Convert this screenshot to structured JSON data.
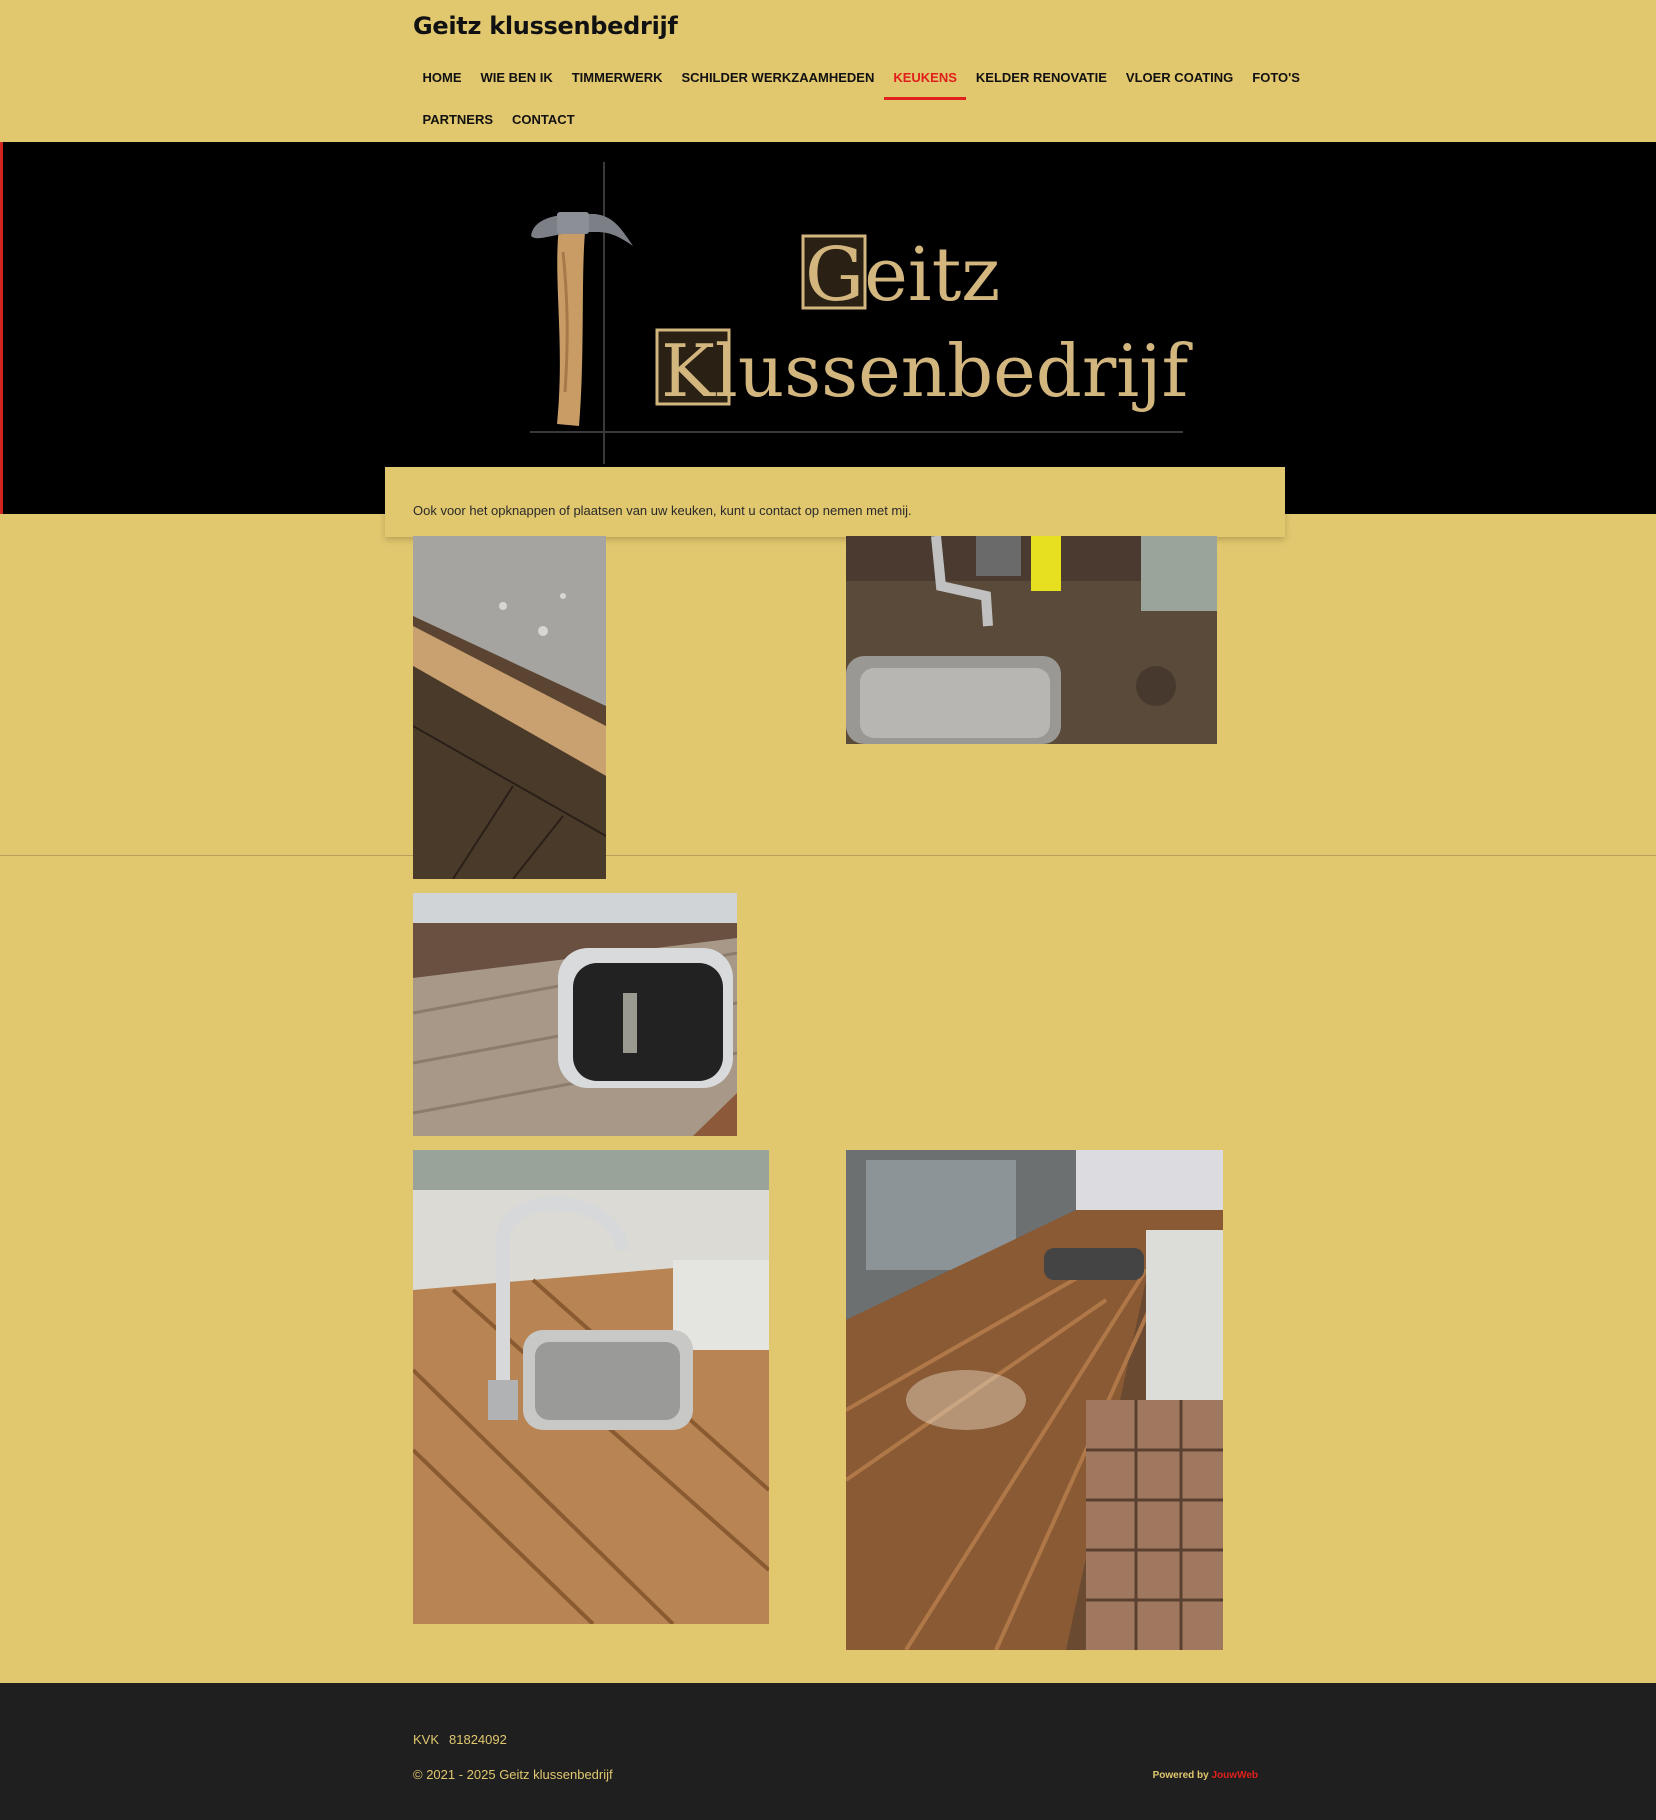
{
  "site": {
    "title": "Geitz klussenbedrijf"
  },
  "nav": {
    "row1": [
      "HOME",
      "WIE BEN IK",
      "TIMMERWERK",
      "SCHILDER WERKZAAMHEDEN",
      "KEUKENS",
      "KELDER RENOVATIE",
      "VLOER COATING",
      "FOTO'S"
    ],
    "row2": [
      "PARTNERS",
      "CONTACT"
    ],
    "active": "KEUKENS"
  },
  "hero": {
    "logo_line1": "Geitz",
    "logo_line2": "Klussenbedrijf"
  },
  "content": {
    "intro": "Ook voor het opknappen of plaatsen van uw keuken, kunt u contact op nemen met mij."
  },
  "photos": [
    {
      "subject": "stainless sink with wet wooden worktop edge"
    },
    {
      "subject": "old weathered worktop with tap and sink"
    },
    {
      "subject": "sanded worktop with removed sink cutout"
    },
    {
      "subject": "finished oak worktop with chrome tap and sink"
    },
    {
      "subject": "varnished worktop along window with sink"
    }
  ],
  "footer": {
    "kvk_label": "KVK",
    "kvk_number": "81824092",
    "copyright": "© 2021 - 2025 Geitz klussenbedrijf",
    "powered_by": "Powered by",
    "powered_brand": "JouwWeb"
  },
  "colors": {
    "background": "#e1c76e",
    "accent": "#e0201c",
    "footer": "#1f1f1f",
    "hero": "#000000"
  },
  "icons": [
    "hammer-logo-icon"
  ]
}
